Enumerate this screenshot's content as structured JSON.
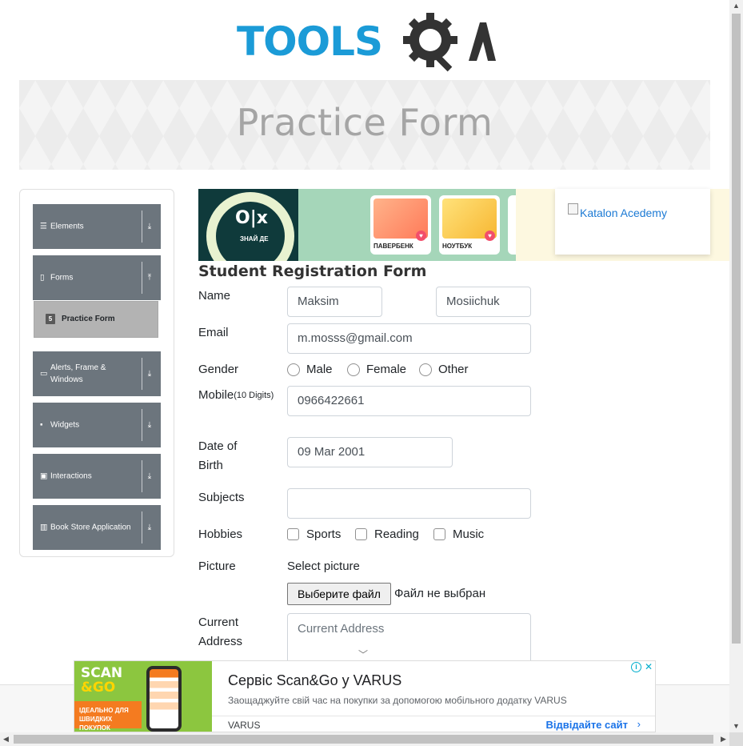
{
  "logo": {
    "text": "TOOLS",
    "qa": "A",
    "accent": "#1b9bd7",
    "dark": "#333333"
  },
  "banner": {
    "title": "Practice Form"
  },
  "sidebar": {
    "groups": [
      {
        "label": "Elements",
        "icon": "list-icon",
        "arrow": "⤓"
      },
      {
        "label": "Forms",
        "icon": "document-icon",
        "arrow": "⤒"
      },
      {
        "label": "Alerts, Frame & Windows",
        "icon": "window-icon",
        "arrow": "⤓"
      },
      {
        "label": "Widgets",
        "icon": "grid-icon",
        "arrow": "⤓"
      },
      {
        "label": "Interactions",
        "icon": "square-icon",
        "arrow": "⤓"
      },
      {
        "label": "Book Store Application",
        "icon": "books-icon",
        "arrow": "⤓"
      }
    ],
    "active_item": {
      "label": "Practice Form",
      "icon": "html5-icon"
    }
  },
  "top_ad": {
    "olx": "O|x",
    "olx_sub": "ЗНАЙ ДЕ",
    "cards": [
      {
        "caption": "ПАВЕРБЕНК"
      },
      {
        "caption": "НОУТБУК"
      }
    ],
    "katalon_alt": "Katalon Acedemy"
  },
  "form": {
    "title": "Student Registration Form",
    "name_label": "Name",
    "first_name": "Maksim",
    "last_name": "Mosiichuk",
    "email_label": "Email",
    "email": "m.mosss@gmail.com",
    "gender_label": "Gender",
    "gender_options": [
      "Male",
      "Female",
      "Other"
    ],
    "mobile_label": "Mobile",
    "mobile_hint": "(10 Digits)",
    "mobile": "0966422661",
    "dob_label_1": "Date of",
    "dob_label_2": "Birth",
    "dob": "09 Mar 2001",
    "subjects_label": "Subjects",
    "hobbies_label": "Hobbies",
    "hobbies": [
      "Sports",
      "Reading",
      "Music"
    ],
    "picture_label": "Picture",
    "picture_caption": "Select picture",
    "file_button": "Выберите файл",
    "file_status": "Файл не выбран",
    "address_label_1": "Current",
    "address_label_2": "Address",
    "address_placeholder": "Current Address"
  },
  "bottom_ad": {
    "scan": "SCAN",
    "go": "&GO",
    "tag_line_1": "ІДЕАЛЬНО ДЛЯ",
    "tag_line_2": "ШВИДКИХ ПОКУПОК",
    "title": "Сервіс Scan&Go у VARUS",
    "description": "Заощаджуйте свій час на покупки за допомогою мобільного додатку VARUS",
    "brand": "VARUS",
    "cta": "Відвідайте сайт",
    "info": "i",
    "close": "✕"
  }
}
